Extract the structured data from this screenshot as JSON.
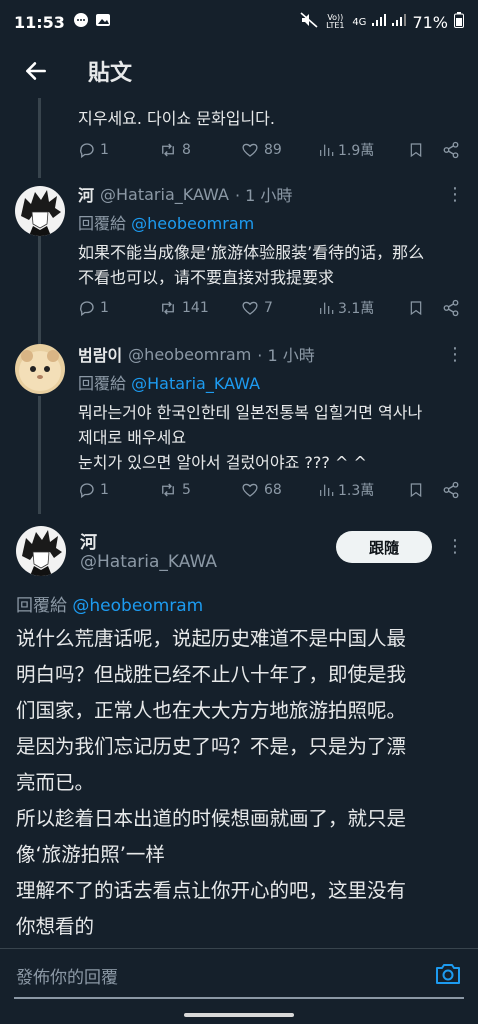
{
  "status_bar": {
    "time": "11:53",
    "network": "4G",
    "volte": "Vo)) LTE1",
    "battery": "71%"
  },
  "header": {
    "title": "貼文"
  },
  "tweets": [
    {
      "body": "지우세요. 다이쇼 문화입니다.",
      "replies": "1",
      "retweets": "8",
      "likes": "89",
      "views": "1.9萬"
    },
    {
      "name": "河",
      "handle": "@Hataria_KAWA",
      "time": "· 1 小時",
      "reply_label": "回覆給",
      "reply_to": "@heobeomram",
      "lines": [
        "如果不能当成像是‘旅游体验服装’看待的话，那么",
        "不看也可以，请不要直接对我提要求"
      ],
      "replies": "1",
      "retweets": "141",
      "likes": "7",
      "views": "3.1萬"
    },
    {
      "name": "범람이",
      "handle": "@heobeomram",
      "time": "· 1 小時",
      "reply_label": "回覆給",
      "reply_to": "@Hataria_KAWA",
      "lines": [
        "뭐라는거야 한국인한테 일본전통복 입힐거면 역사나",
        "제대로 배우세요",
        "눈치가 있으면 알아서 걸렀어야죠 ??? ^ ^"
      ],
      "replies": "1",
      "retweets": "5",
      "likes": "68",
      "views": "1.3萬"
    }
  ],
  "main_tweet": {
    "name": "河",
    "handle": "@Hataria_KAWA",
    "follow_label": "跟隨",
    "reply_label": "回覆給",
    "reply_to": "@heobeomram",
    "lines": [
      "说什么荒唐话呢，说起历史难道不是中国人最",
      "明白吗？但战胜已经不止八十年了，即使是我",
      "们国家，正常人也在大大方方地旅游拍照呢。",
      "是因为我们忘记历史了吗？不是，只是为了漂",
      "亮而已。",
      "所以趁着日本出道的时候想画就画了，就只是",
      "像‘旅游拍照’一样",
      "理解不了的话去看点让你开心的吧，这里没有",
      "你想看的"
    ]
  },
  "compose": {
    "placeholder": "發佈你的回覆"
  },
  "icons": {
    "back": "arrow-left-icon",
    "reply": "speech-bubble-icon",
    "retweet": "retweet-icon",
    "like": "heart-icon",
    "views": "bar-chart-icon",
    "bookmark": "bookmark-icon",
    "share": "share-icon",
    "more": "more-vertical-icon",
    "camera": "camera-icon"
  },
  "colors": {
    "background": "#15202b",
    "accent": "#1d9bf0",
    "muted": "#8b98a5"
  }
}
